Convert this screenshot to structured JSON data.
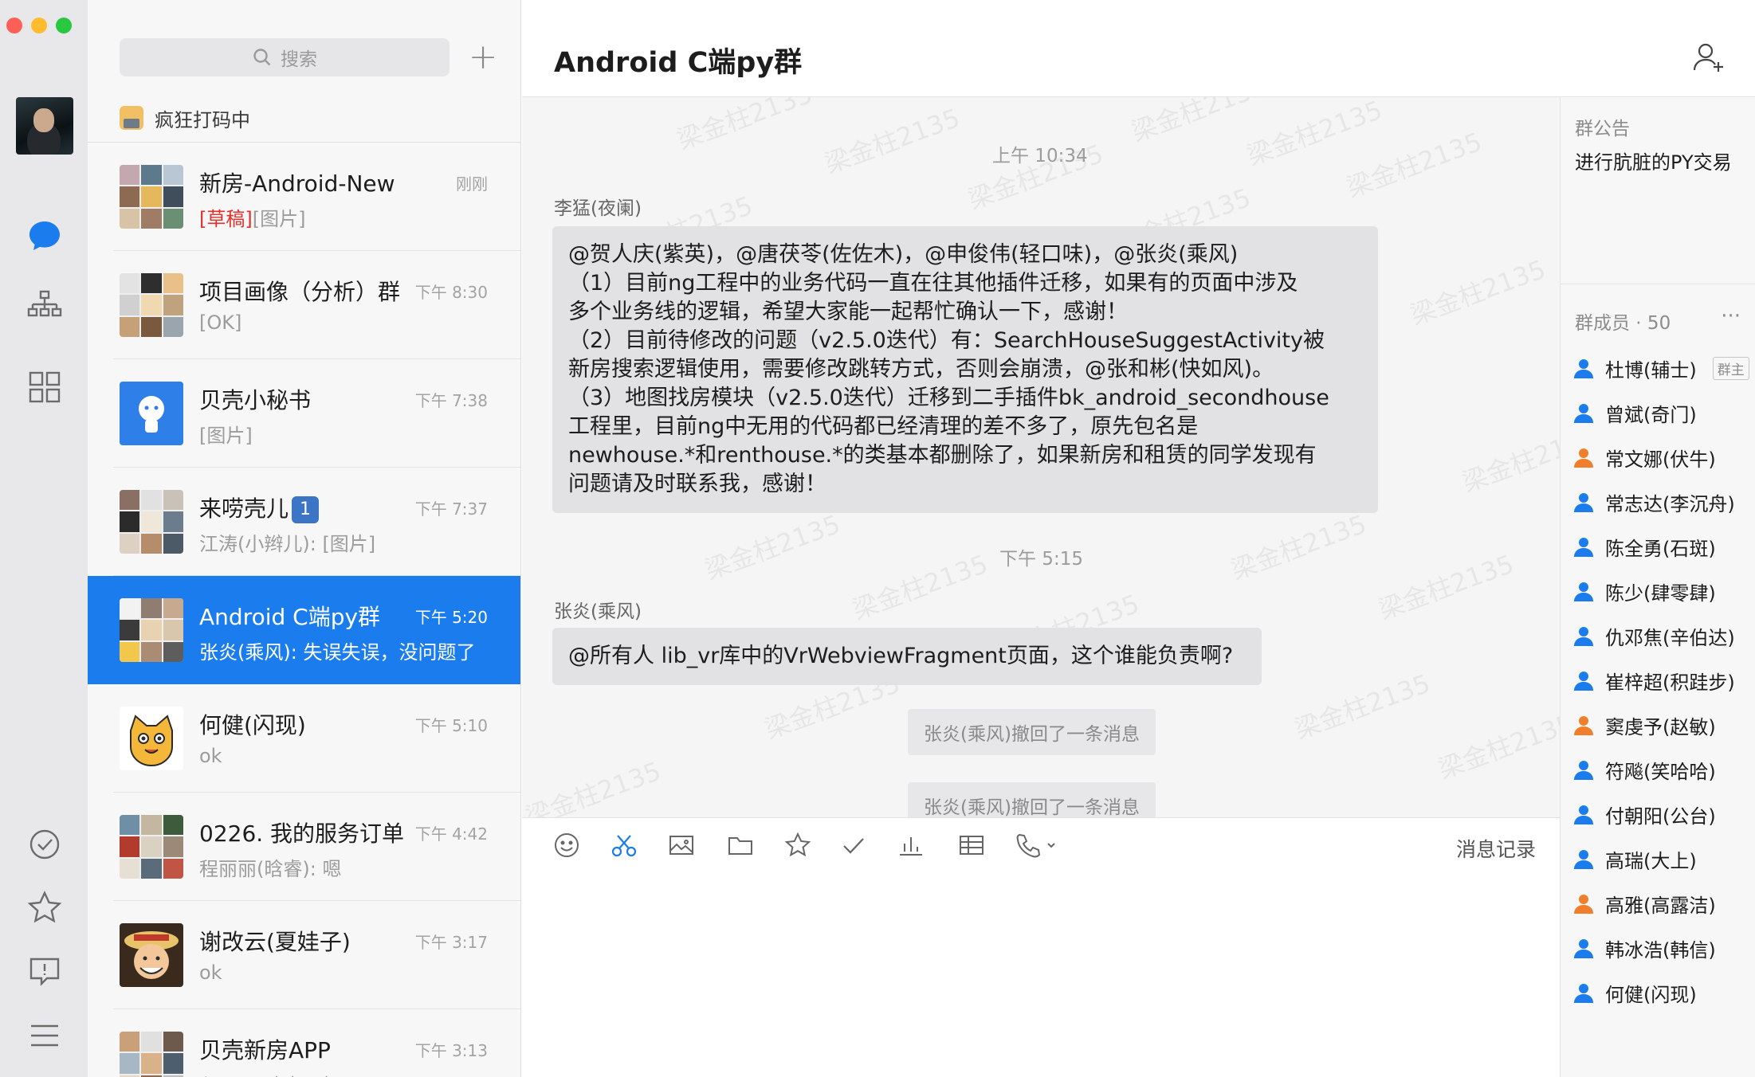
{
  "rail": {
    "icons": [
      "chat-bubble-icon",
      "org-chart-icon",
      "apps-grid-icon",
      "todo-check-icon",
      "star-icon",
      "feedback-icon",
      "menu-icon"
    ],
    "active_color": "#1a7ced"
  },
  "list": {
    "search_placeholder": "搜索",
    "plus_label": "+",
    "status_text": "疯狂打码中",
    "items": [
      {
        "name": "新房-Android-New",
        "time": "刚刚",
        "draft_tag": "[草稿]",
        "preview": "[图片]"
      },
      {
        "name": "项目画像（分析）群",
        "time": "下午 8:30",
        "preview": "[OK]"
      },
      {
        "name": "贝壳小秘书",
        "time": "下午 7:38",
        "preview": "[图片]"
      },
      {
        "name": "来唠壳儿",
        "badge": "1",
        "time": "下午 7:37",
        "preview": "江涛(小辫儿): [图片]"
      },
      {
        "name": "Android C端py群",
        "time": "下午 5:20",
        "preview": "张炎(乘风): 失误失误，没问题了"
      },
      {
        "name": "何健(闪现)",
        "time": "下午 5:10",
        "preview": "ok"
      },
      {
        "name": "0226. 我的服务订单",
        "time": "下午 4:42",
        "preview": "程丽丽(晗睿): 嗯"
      },
      {
        "name": "谢改云(夏娃子)",
        "time": "下午 3:17",
        "preview": "ok"
      },
      {
        "name": "贝壳新房APP",
        "time": "下午 3:13",
        "preview": "程丽丽(晗睿): 好"
      }
    ]
  },
  "header": {
    "title": "Android C端py群"
  },
  "messages": {
    "watermark": "梁金柱2135",
    "timestamp1": "上午 10:34",
    "sender1": "李猛(夜阑)",
    "msg1_lines": [
      "@贺人庆(紫英)，@唐茯苓(佐佐木)，@申俊伟(轻口味)，@张炎(乘风)",
      "（1）目前ng工程中的业务代码一直在往其他插件迁移，如果有的页面中涉及",
      "多个业务线的逻辑，希望大家能一起帮忙确认一下，感谢！",
      "（2）目前待修改的问题（v2.5.0迭代）有：SearchHouseSuggestActivity被",
      "新房搜索逻辑使用，需要修改跳转方式，否则会崩溃，@张和彬(快如风)。",
      "（3）地图找房模块（v2.5.0迭代）迁移到二手插件bk_android_secondhouse",
      "工程里，目前ng中无用的代码都已经清理的差不多了，原先包名是",
      "newhouse.*和renthouse.*的类基本都删除了，如果新房和租赁的同学发现有",
      "问题请及时联系我，感谢！"
    ],
    "timestamp2": "下午 5:15",
    "sender2": "张炎(乘风)",
    "msg2": "@所有人 lib_vr库中的VrWebviewFragment页面，这个谁能负责啊?",
    "recall1": "张炎(乘风)撤回了一条消息",
    "recall2": "张炎(乘风)撤回了一条消息"
  },
  "composer": {
    "tools": [
      "emoji-icon",
      "scissors-icon",
      "image-icon",
      "folder-icon",
      "star-icon",
      "check-icon",
      "chart-icon",
      "table-icon",
      "phone-icon"
    ],
    "history_label": "消息记录"
  },
  "panel": {
    "notice_title": "群公告",
    "notice_text": "进行肮脏的PY交易",
    "members_title": "群成员 · 50",
    "more": "···",
    "owner_tag": "群主",
    "members": [
      {
        "name": "杜博(辅士)",
        "color": "#1a7ced"
      },
      {
        "name": "曾斌(奇门)",
        "color": "#1a7ced"
      },
      {
        "name": "常文娜(伏牛)",
        "color": "#f07f2b"
      },
      {
        "name": "常志达(李沉舟)",
        "color": "#1a7ced"
      },
      {
        "name": "陈全勇(石斑)",
        "color": "#1a7ced"
      },
      {
        "name": "陈少(肆零肆)",
        "color": "#1a7ced"
      },
      {
        "name": "仇邓焦(辛伯达)",
        "color": "#1a7ced"
      },
      {
        "name": "崔梓超(积跬步)",
        "color": "#1a7ced"
      },
      {
        "name": "窦虔予(赵敏)",
        "color": "#f07f2b"
      },
      {
        "name": "符飚(笑哈哈)",
        "color": "#1a7ced"
      },
      {
        "name": "付朝阳(公台)",
        "color": "#1a7ced"
      },
      {
        "name": "高瑞(大上)",
        "color": "#1a7ced"
      },
      {
        "name": "高雅(高露洁)",
        "color": "#f07f2b"
      },
      {
        "name": "韩冰浩(韩信)",
        "color": "#1a7ced"
      },
      {
        "name": "何健(闪现)",
        "color": "#1a7ced"
      }
    ]
  }
}
